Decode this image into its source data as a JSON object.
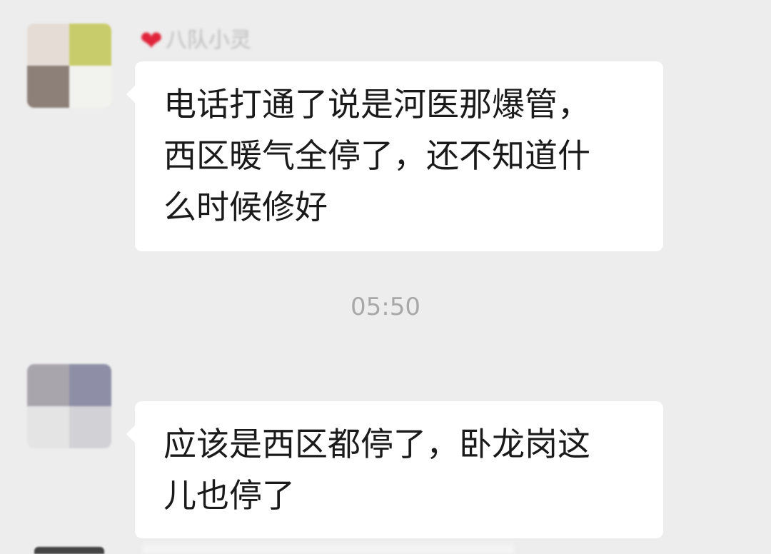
{
  "messages": [
    {
      "sender": "八队小灵",
      "text": "电话打通了说是河医那爆管，\n西区暖气全停了，还不知道什\n么时候修好"
    },
    {
      "sender": "",
      "text": "应该是西区都停了，卧龙岗这\n儿也停了"
    }
  ],
  "timestamp": "05:50",
  "colors": {
    "background": "#ededed",
    "bubble": "#ffffff",
    "text": "#1a1a1a",
    "timestamp": "#a8a8a8",
    "heart": "#e0243b"
  },
  "icons": {
    "sender_badge": "heart-icon"
  }
}
